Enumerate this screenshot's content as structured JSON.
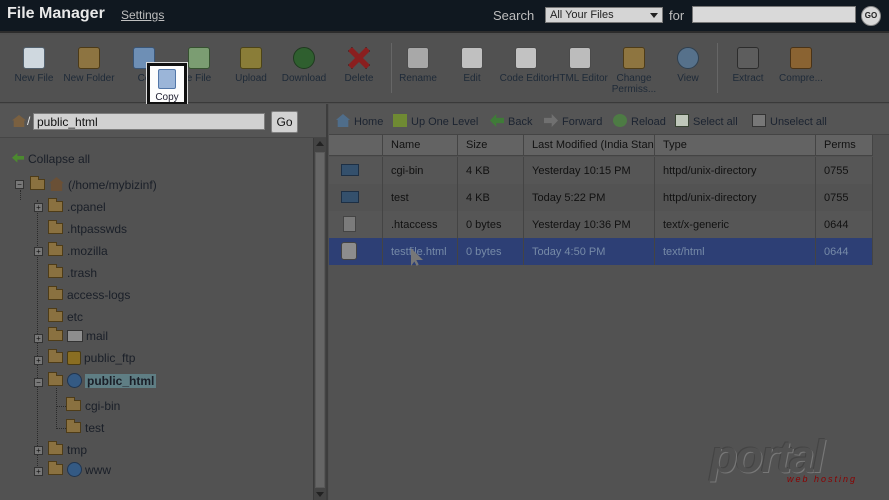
{
  "header": {
    "title": "File Manager",
    "settings": "Settings",
    "search_label": "Search",
    "search_scope": "All Your Files",
    "for_label": "for",
    "search_value": "",
    "go": "GO"
  },
  "toolbar": {
    "new_file": "New File",
    "new_folder": "New Folder",
    "copy_partial": "Co",
    "move_partial": "e File",
    "upload": "Upload",
    "download": "Download",
    "delete": "Delete",
    "rename": "Rename",
    "edit": "Edit",
    "code_editor": "Code Editor",
    "html_editor": "HTML Editor",
    "change_permissions": "Change Permiss...",
    "view": "View",
    "extract": "Extract",
    "compress": "Compre...",
    "copy_tooltip": "Copy"
  },
  "path": {
    "slash": "/",
    "value": "public_html",
    "go": "Go"
  },
  "tree": {
    "collapse_all": "Collapse all",
    "root": "(/home/mybizinf)",
    "items": [
      ".cpanel",
      ".htpasswds",
      ".mozilla",
      ".trash",
      "access-logs",
      "etc",
      "mail",
      "public_ftp",
      "public_html",
      "cgi-bin",
      "test",
      "tmp",
      "www"
    ]
  },
  "file_toolbar": {
    "home": "Home",
    "up_one_level": "Up One Level",
    "back": "Back",
    "forward": "Forward",
    "reload": "Reload",
    "select_all": "Select all",
    "unselect_all": "Unselect all"
  },
  "table": {
    "headers": [
      "Name",
      "Size",
      "Last Modified (India Stand",
      "Type",
      "Perms"
    ],
    "rows": [
      [
        "cgi-bin",
        "4 KB",
        "Yesterday 10:15 PM",
        "httpd/unix-directory",
        "0755"
      ],
      [
        "test",
        "4 KB",
        "Today 5:22 PM",
        "httpd/unix-directory",
        "0755"
      ],
      [
        ".htaccess",
        "0 bytes",
        "Yesterday 10:36 PM",
        "text/x-generic",
        "0644"
      ],
      [
        "testfile.html",
        "0 bytes",
        "Today 4:50 PM",
        "text/html",
        "0644"
      ]
    ]
  },
  "watermark": {
    "brand": "portal",
    "subtitle": "web hosting"
  }
}
